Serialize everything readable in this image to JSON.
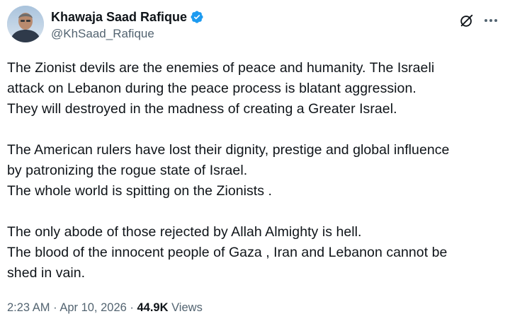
{
  "author": {
    "display_name": "Khawaja Saad Rafique",
    "handle": "@KhSaad_Rafique",
    "verified_icon": "verified-badge-icon",
    "verified_color": "#1d9bf0"
  },
  "actions": {
    "grok_icon": "grok-icon",
    "more_icon": "more-dots-icon"
  },
  "post": {
    "paragraphs": [
      {
        "lines": [
          "The Zionist devils are the enemies of peace and humanity. The Israeli",
          "attack on Lebanon during the peace process is blatant aggression.",
          "They will destroyed in the madness of creating a Greater Israel."
        ]
      },
      {
        "lines": [
          "The American rulers have lost their dignity, prestige and global influence",
          "by patronizing the rogue state of Israel.",
          "The whole world is spitting on the Zionists ."
        ]
      },
      {
        "lines": [
          "The only abode of those rejected by Allah  Almighty is hell.",
          "The blood of the innocent people of Gaza , Iran and Lebanon cannot be",
          "shed in vain."
        ]
      }
    ]
  },
  "meta": {
    "time": "2:23 AM",
    "separator1": " · ",
    "date": "Apr 10, 2026",
    "separator2": " · ",
    "views_count": "44.9K",
    "views_label": " Views"
  }
}
